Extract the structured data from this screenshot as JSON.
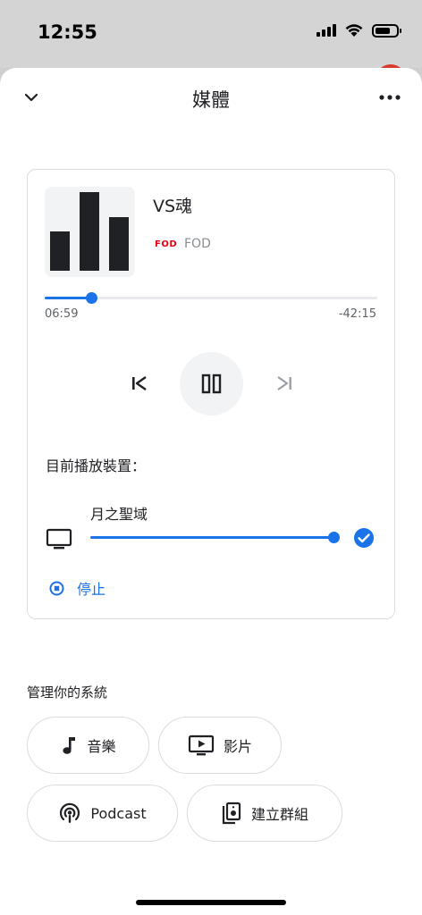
{
  "status_bar": {
    "time": "12:55"
  },
  "header": {
    "title": "媒體"
  },
  "player": {
    "title": "VS魂",
    "source_logo": "FOD",
    "source_name": "FOD",
    "elapsed": "06:59",
    "remaining": "-42:15",
    "progress_fraction": 0.14
  },
  "device": {
    "heading": "目前播放裝置：",
    "name": "月之聖域",
    "volume_fraction": 1.0,
    "stop_label": "停止"
  },
  "manage": {
    "heading": "管理你的系統",
    "chips": [
      {
        "label": "音樂",
        "icon": "music-note-icon"
      },
      {
        "label": "影片",
        "icon": "video-icon"
      },
      {
        "label": "Podcast",
        "icon": "podcast-icon"
      },
      {
        "label": "建立群組",
        "icon": "speaker-group-icon"
      }
    ]
  },
  "colors": {
    "accent": "#1a73e8",
    "fod_red": "#e50012"
  }
}
